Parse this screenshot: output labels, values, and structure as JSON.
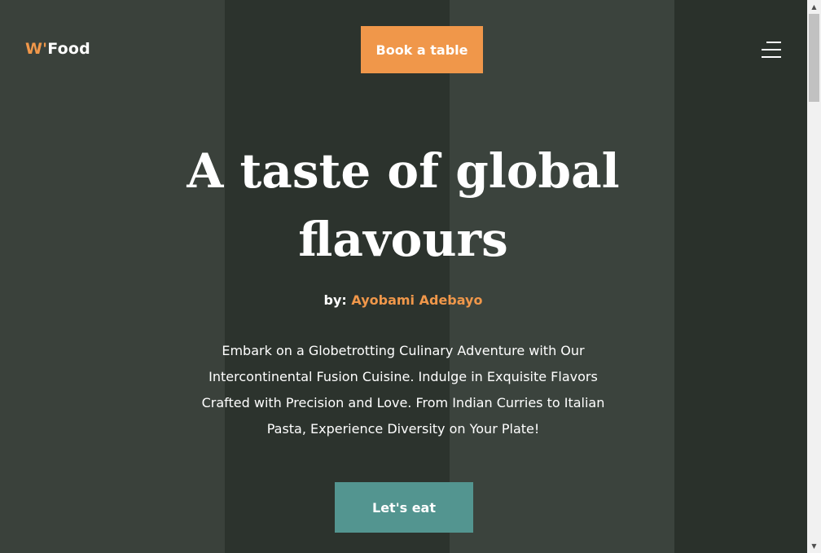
{
  "header": {
    "logo_accent": "W'",
    "logo_text": "Food",
    "book_label": "Book a table",
    "menu_icon": "hamburger-menu-icon"
  },
  "hero": {
    "title": "A taste of global flavours",
    "byline_prefix": "by:",
    "author": "Ayobami Adebayo",
    "description": "Embark on a Globetrotting Culinary Adventure with Our Intercontinental Fusion Cuisine. Indulge in Exquisite Flavors Crafted with Precision and Love. From Indian Curries to Italian Pasta, Experience Diversity on Your Plate!",
    "cta_label": "Let's eat"
  },
  "scrollbar": {
    "up_icon": "▲",
    "down_icon": "▼"
  },
  "colors": {
    "accent": "#f0974a",
    "cta": "#539590",
    "background": "#2c332e"
  }
}
